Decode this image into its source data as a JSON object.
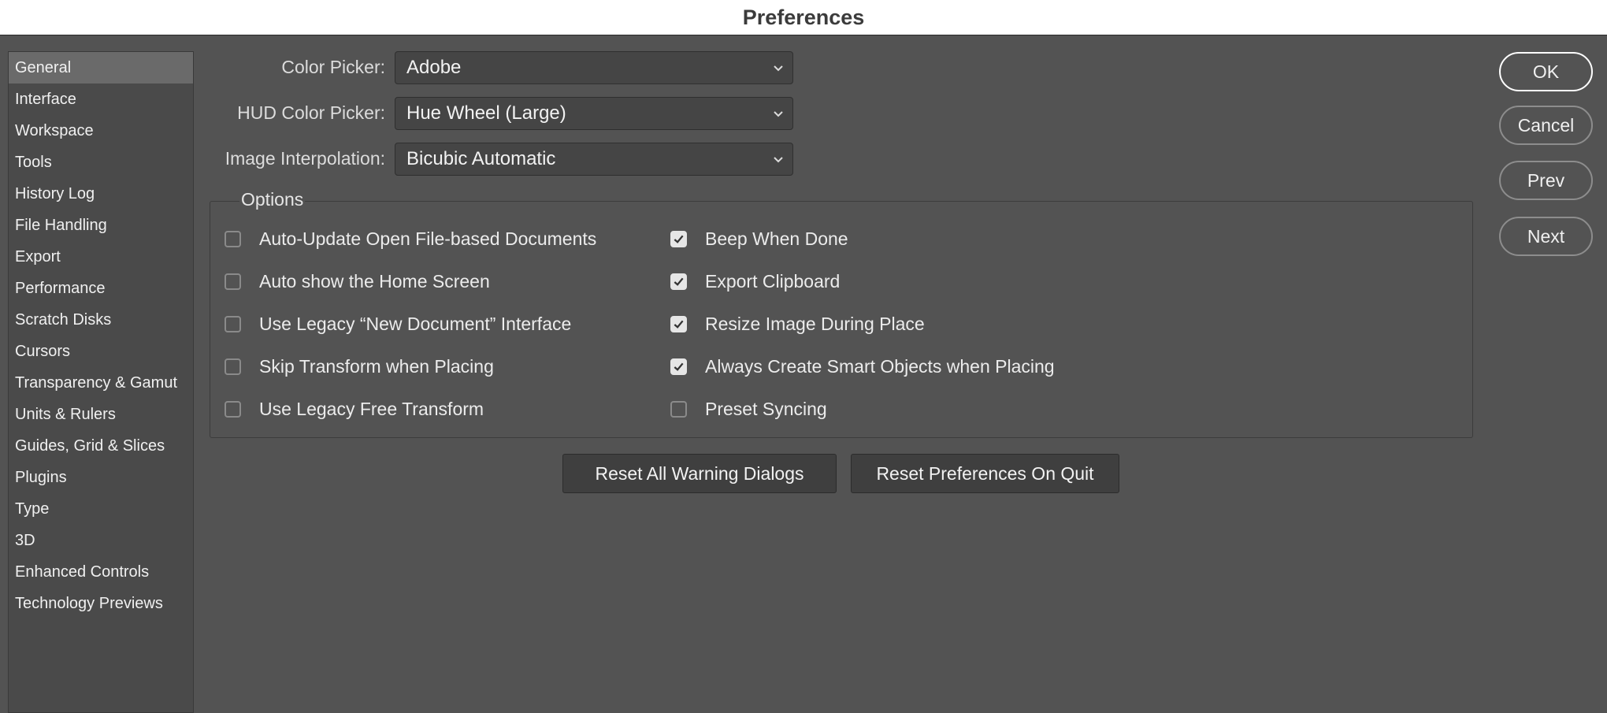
{
  "window": {
    "title": "Preferences"
  },
  "sidebar": {
    "items": [
      {
        "label": "General",
        "selected": true
      },
      {
        "label": "Interface"
      },
      {
        "label": "Workspace"
      },
      {
        "label": "Tools"
      },
      {
        "label": "History Log"
      },
      {
        "label": "File Handling"
      },
      {
        "label": "Export"
      },
      {
        "label": "Performance"
      },
      {
        "label": "Scratch Disks"
      },
      {
        "label": "Cursors"
      },
      {
        "label": "Transparency & Gamut"
      },
      {
        "label": "Units & Rulers"
      },
      {
        "label": "Guides, Grid & Slices"
      },
      {
        "label": "Plugins"
      },
      {
        "label": "Type"
      },
      {
        "label": "3D"
      },
      {
        "label": "Enhanced Controls"
      },
      {
        "label": "Technology Previews"
      }
    ]
  },
  "fields": {
    "color_picker": {
      "label": "Color Picker:",
      "value": "Adobe"
    },
    "hud_color_picker": {
      "label": "HUD Color Picker:",
      "value": "Hue Wheel (Large)"
    },
    "image_interpolation": {
      "label": "Image Interpolation:",
      "value": "Bicubic Automatic"
    }
  },
  "options": {
    "title": "Options",
    "left": [
      {
        "label": "Auto-Update Open File-based Documents",
        "checked": false
      },
      {
        "label": "Auto show the Home Screen",
        "checked": false
      },
      {
        "label": "Use Legacy “New Document” Interface",
        "checked": false
      },
      {
        "label": "Skip Transform when Placing",
        "checked": false
      },
      {
        "label": "Use Legacy Free Transform",
        "checked": false
      }
    ],
    "right": [
      {
        "label": "Beep When Done",
        "checked": true
      },
      {
        "label": "Export Clipboard",
        "checked": true
      },
      {
        "label": "Resize Image During Place",
        "checked": true
      },
      {
        "label": "Always Create Smart Objects when Placing",
        "checked": true
      },
      {
        "label": "Preset Syncing",
        "checked": false
      }
    ]
  },
  "buttons": {
    "reset_warnings": "Reset All Warning Dialogs",
    "reset_prefs": "Reset Preferences On Quit",
    "ok": "OK",
    "cancel": "Cancel",
    "prev": "Prev",
    "next": "Next"
  }
}
